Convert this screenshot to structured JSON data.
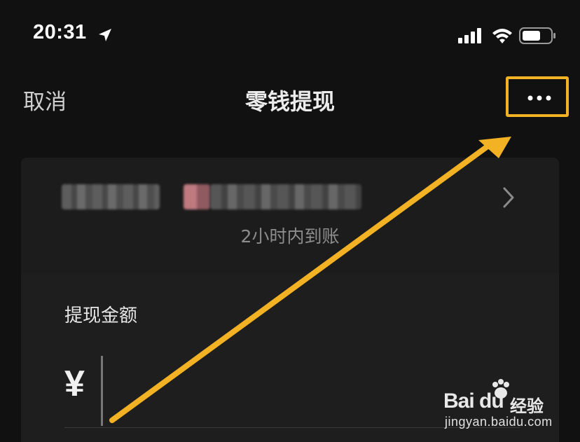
{
  "status_bar": {
    "time": "20:31",
    "icons": [
      "location-arrow-icon",
      "cellular-signal-icon",
      "wifi-icon",
      "battery-icon"
    ]
  },
  "nav": {
    "cancel_label": "取消",
    "title": "零钱提现",
    "more_icon": "more-dots-icon"
  },
  "withdraw_target": {
    "bank_info": "",
    "arrival_time": "2小时内到账",
    "chevron_icon": "chevron-right-icon"
  },
  "amount": {
    "label": "提现金额",
    "currency_symbol": "¥",
    "value": ""
  },
  "annotation": {
    "highlight_color": "#f3b223",
    "arrow_color": "#f3b223"
  },
  "watermark": {
    "brand": "Bai du",
    "brand_cn": "经验",
    "url": "jingyan.baidu.com"
  }
}
